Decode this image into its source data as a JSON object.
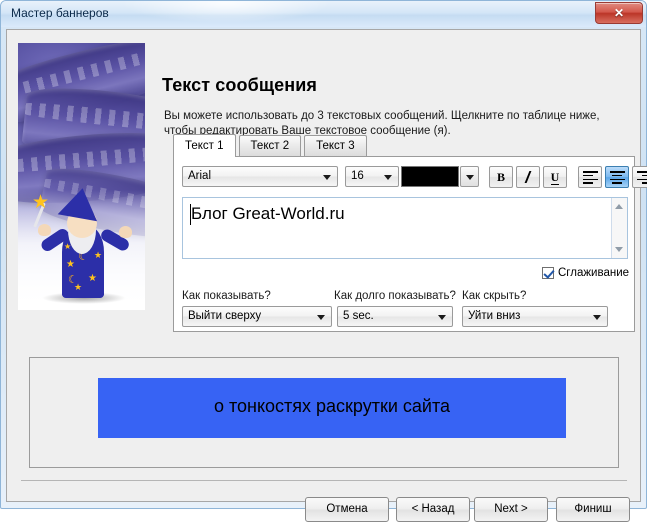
{
  "window": {
    "title": "Мастер баннеров",
    "close_label": "✕"
  },
  "content": {
    "heading": "Текст сообщения",
    "description": "Вы можете использовать до 3 текстовых сообщений. Щелкните по таблице ниже, чтобы редактировать Ваше текстовое сообщение (я)."
  },
  "tabs": [
    {
      "label": "Текст 1",
      "active": true
    },
    {
      "label": "Текст 2",
      "active": false
    },
    {
      "label": "Текст 3",
      "active": false
    }
  ],
  "toolbar": {
    "font_family": "Arial",
    "font_size": "16",
    "text_color": "#000000",
    "bold_label": "B",
    "italic_label": "I",
    "underline_label": "U",
    "align_left": "align-left",
    "align_center": "align-center",
    "align_right": "align-right",
    "active_alignment": "align-center"
  },
  "editor": {
    "text": "Блог Great-World.ru"
  },
  "antialias": {
    "label": "Сглаживание",
    "checked": true
  },
  "options": [
    {
      "label": "Как показывать?",
      "value": "Выйти сверху"
    },
    {
      "label": "Как долго показывать?",
      "value": "5 sec."
    },
    {
      "label": "Как скрыть?",
      "value": "Уйти вниз"
    }
  ],
  "preview": {
    "banner_text": "о тонкостях раскрутки сайта",
    "banner_color": "#3763f4"
  },
  "footer": {
    "cancel": "Отмена",
    "back": "< Назад",
    "next": "Next >",
    "finish": "Финиш"
  }
}
